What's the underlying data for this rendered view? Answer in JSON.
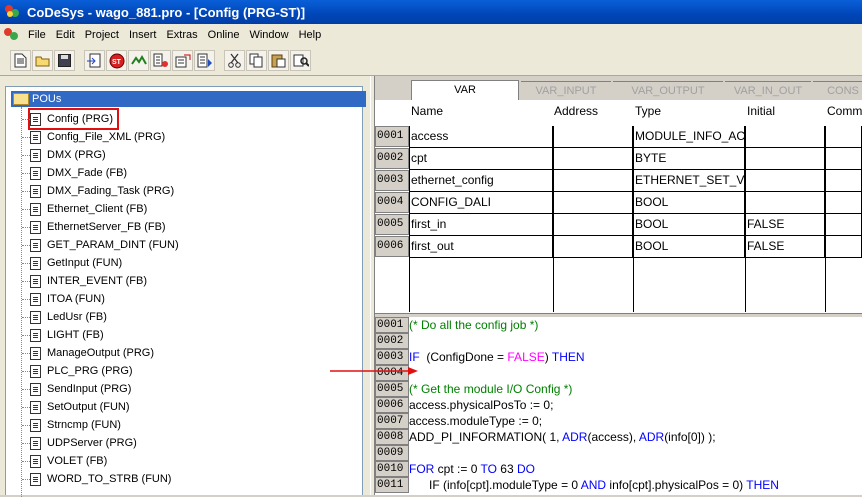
{
  "window": {
    "title": "CoDeSys - wago_881.pro - [Config (PRG-ST)]"
  },
  "menu": [
    "File",
    "Edit",
    "Project",
    "Insert",
    "Extras",
    "Online",
    "Window",
    "Help"
  ],
  "toolbar": {
    "buttons": [
      "new-icon",
      "open-icon",
      "save-icon",
      "sep",
      "login-icon",
      "run-stop-icon",
      "reset-icon",
      "breakpoint-icon",
      "step-over-icon",
      "step-in-icon",
      "sep",
      "cut-icon",
      "copy-icon",
      "paste-icon",
      "find-icon"
    ]
  },
  "tree": {
    "root": "POUs",
    "items": [
      {
        "label": "Config (PRG)",
        "icon": "st",
        "selected": true
      },
      {
        "label": "Config_File_XML (PRG)",
        "icon": "st"
      },
      {
        "label": "DMX (PRG)",
        "icon": "fbd"
      },
      {
        "label": "DMX_Fade (FB)",
        "icon": "st"
      },
      {
        "label": "DMX_Fading_Task (PRG)",
        "icon": "st"
      },
      {
        "label": "Ethernet_Client (FB)",
        "icon": "st"
      },
      {
        "label": "EthernetServer_FB (FB)",
        "icon": "st"
      },
      {
        "label": "GET_PARAM_DINT (FUN)",
        "icon": "st"
      },
      {
        "label": "GetInput (FUN)",
        "icon": "st"
      },
      {
        "label": "INTER_EVENT (FB)",
        "icon": "st"
      },
      {
        "label": "ITOA (FUN)",
        "icon": "st"
      },
      {
        "label": "LedUsr (FB)",
        "icon": "st"
      },
      {
        "label": "LIGHT (FB)",
        "icon": "st"
      },
      {
        "label": "ManageOutput (PRG)",
        "icon": "st"
      },
      {
        "label": "PLC_PRG (PRG)",
        "icon": "st"
      },
      {
        "label": "SendInput (PRG)",
        "icon": "st"
      },
      {
        "label": "SetOutput (FUN)",
        "icon": "st"
      },
      {
        "label": "Strncmp (FUN)",
        "icon": "st"
      },
      {
        "label": "UDPServer (PRG)",
        "icon": "st"
      },
      {
        "label": "VOLET (FB)",
        "icon": "st"
      },
      {
        "label": "WORD_TO_STRB (FUN)",
        "icon": "st"
      }
    ]
  },
  "tabs": [
    "VAR",
    "VAR_INPUT",
    "VAR_OUTPUT",
    "VAR_IN_OUT",
    "CONS"
  ],
  "columns": [
    "Name",
    "Address",
    "Type",
    "Initial",
    "Comm"
  ],
  "vars": [
    {
      "num": "0001",
      "name": "access",
      "address": "",
      "type": "MODULE_INFO_AC",
      "initial": ""
    },
    {
      "num": "0002",
      "name": "cpt",
      "address": "",
      "type": "BYTE",
      "initial": ""
    },
    {
      "num": "0003",
      "name": "ethernet_config",
      "address": "",
      "type": "ETHERNET_SET_V",
      "initial": ""
    },
    {
      "num": "0004",
      "name": "CONFIG_DALI",
      "address": "",
      "type": "BOOL",
      "initial": ""
    },
    {
      "num": "0005",
      "name": "first_in",
      "address": "",
      "type": "BOOL",
      "initial": "FALSE"
    },
    {
      "num": "0006",
      "name": "first_out",
      "address": "",
      "type": "BOOL",
      "initial": "FALSE"
    }
  ],
  "code": [
    {
      "num": "0001",
      "segs": [
        [
          "cmt",
          "(* Do all the config job *)"
        ]
      ]
    },
    {
      "num": "0002",
      "segs": []
    },
    {
      "num": "0003",
      "segs": [
        [
          "kw",
          "IF"
        ],
        [
          "",
          "  (ConfigDone = "
        ],
        [
          "bool",
          "FALSE"
        ],
        [
          "",
          ") "
        ],
        [
          "kw",
          "THEN"
        ]
      ]
    },
    {
      "num": "0004",
      "segs": []
    },
    {
      "num": "0005",
      "segs": [
        [
          "cmt",
          "(* Get the module I/O Config *)"
        ]
      ]
    },
    {
      "num": "0006",
      "segs": [
        [
          "",
          "access.physicalPosTo := 0;"
        ]
      ]
    },
    {
      "num": "0007",
      "segs": [
        [
          "",
          "access.moduleType := 0;"
        ]
      ]
    },
    {
      "num": "0008",
      "segs": [
        [
          "",
          "ADD_PI_INFORMATION( 1, "
        ],
        [
          "kw",
          "ADR"
        ],
        [
          "",
          "(access), "
        ],
        [
          "kw",
          "ADR"
        ],
        [
          "",
          "(info[0]) );"
        ]
      ]
    },
    {
      "num": "0009",
      "segs": []
    },
    {
      "num": "0010",
      "segs": [
        [
          "kw",
          "FOR"
        ],
        [
          "",
          " cpt := 0 "
        ],
        [
          "kw",
          "TO"
        ],
        [
          "",
          " 63 "
        ],
        [
          "kw",
          "DO"
        ]
      ]
    },
    {
      "num": "0011",
      "segs": [
        [
          "",
          "      IF (info[cpt].moduleType = 0 "
        ],
        [
          "kw",
          "AND"
        ],
        [
          "",
          " info[cpt].physicalPos = 0) "
        ],
        [
          "kw",
          "THEN"
        ]
      ]
    }
  ],
  "colors": {
    "comment": "#008000",
    "keyword": "#0000ff",
    "boolean": "#ff00ff",
    "highlight_box": "#e01010",
    "arrow": "#e01010",
    "selection": "#316ac5"
  }
}
